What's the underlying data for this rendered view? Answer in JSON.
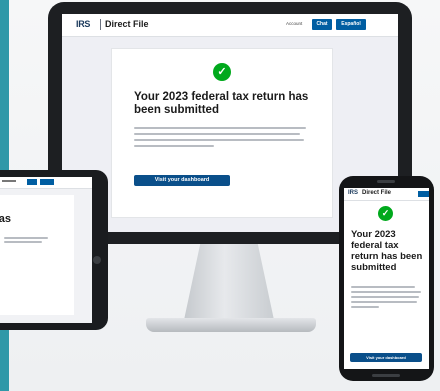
{
  "brand": {
    "logo": "IRS",
    "product": "Direct File"
  },
  "header": {
    "account_link": "Account",
    "lang_primary": "Chat",
    "lang_secondary": "Español"
  },
  "confirmation": {
    "title": "Your 2023 federal tax return has been submitted",
    "button": "Visit your dashboard"
  },
  "colors": {
    "success": "#00a91c",
    "primary": "#0a4f8a",
    "brand": "#1b3a5c"
  },
  "icons": {
    "success": "check-circle-icon"
  }
}
